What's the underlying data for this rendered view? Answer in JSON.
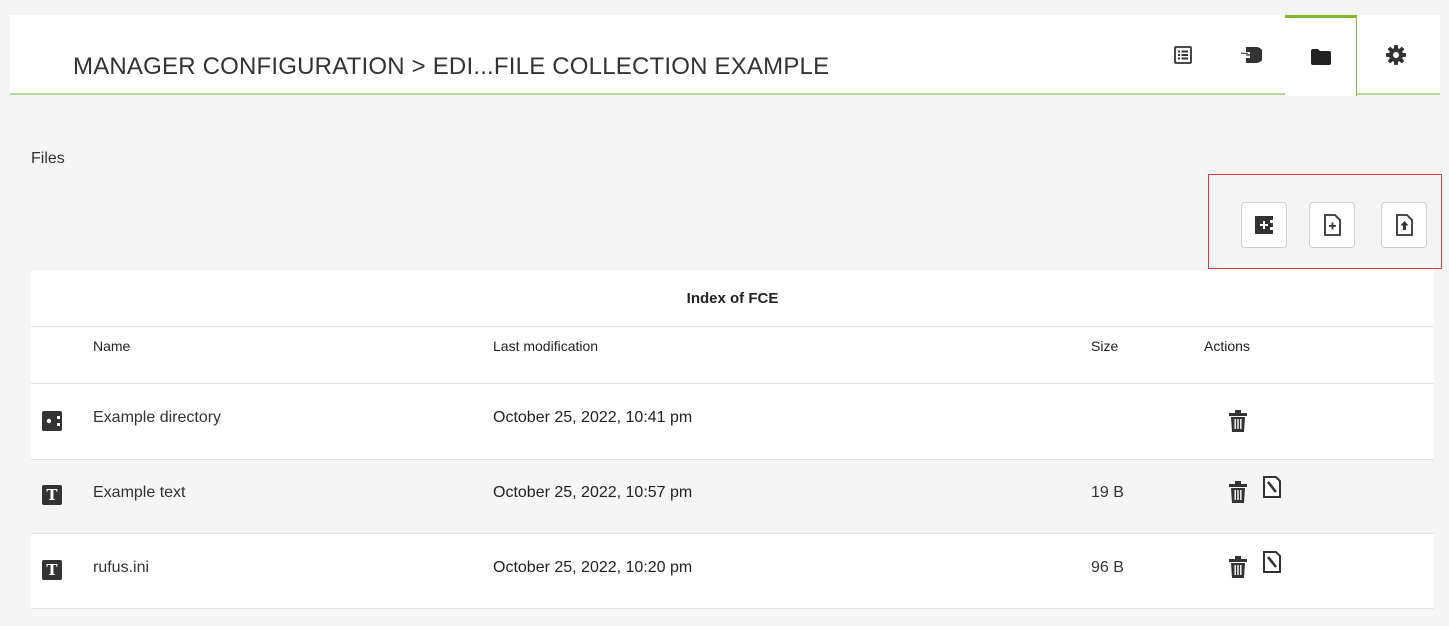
{
  "header": {
    "title": "MANAGER CONFIGURATION > EDI...FILE COLLECTION EXAMPLE",
    "tabs": [
      {
        "icon": "list-icon",
        "active": false
      },
      {
        "icon": "plugin-icon",
        "active": false
      },
      {
        "icon": "folder-icon",
        "active": true
      },
      {
        "icon": "gear-icon",
        "active": false
      }
    ]
  },
  "section": {
    "label": "Files"
  },
  "actions": [
    {
      "icon": "create-folder-icon"
    },
    {
      "icon": "create-text-file-icon"
    },
    {
      "icon": "upload-file-icon"
    }
  ],
  "table": {
    "caption": "Index of FCE",
    "columns": [
      "Name",
      "Last modification",
      "Size",
      "Actions"
    ],
    "rows": [
      {
        "type": "directory",
        "name": "Example directory",
        "modified": "October 25, 2022, 10:41 pm",
        "size": "",
        "actions": [
          "delete-icon"
        ]
      },
      {
        "type": "text",
        "name": "Example text",
        "modified": "October 25, 2022, 10:57 pm",
        "size": "19 B",
        "actions": [
          "delete-icon",
          "edit-icon"
        ]
      },
      {
        "type": "text",
        "name": "rufus.ini",
        "modified": "October 25, 2022, 10:20 pm",
        "size": "96 B",
        "actions": [
          "delete-icon",
          "edit-icon"
        ]
      }
    ]
  },
  "colors": {
    "accent_green": "#82b92e",
    "highlight_red": "#e03a3a",
    "icon_dark": "#333333"
  }
}
